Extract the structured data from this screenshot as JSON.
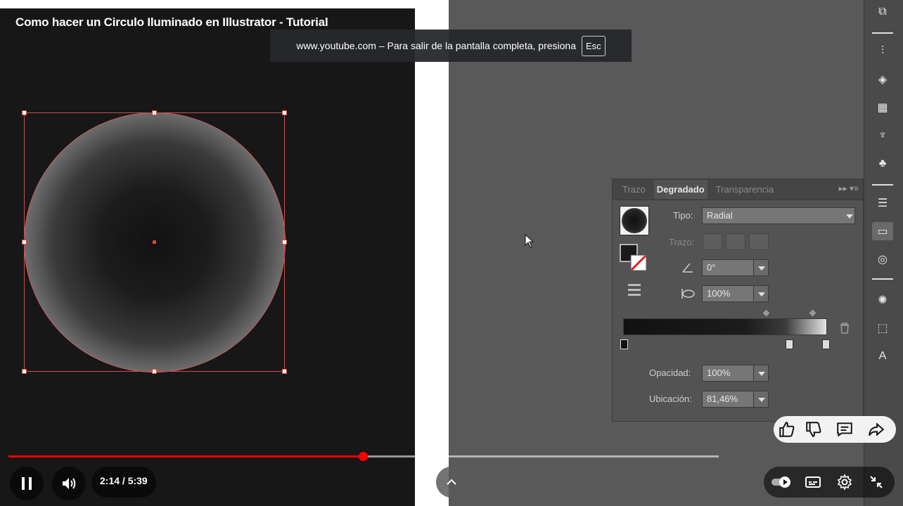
{
  "video": {
    "title": "Como hacer un Circulo Iluminado en Illustrator - Tutorial",
    "time_current": "2:14",
    "time_total": "5:39",
    "time_display": "2:14 / 5:39",
    "progress": 0.4,
    "buffered": 1.0
  },
  "fullscreen_banner": {
    "message": "www.youtube.com – Para salir de la pantalla completa, presiona",
    "key": "Esc"
  },
  "gradient_panel": {
    "tabs": [
      "Trazo",
      "Degradado",
      "Transparencia"
    ],
    "active_tab": "Degradado",
    "tipo_label": "Tipo:",
    "tipo_value": "Radial",
    "trazo_label": "Trazo:",
    "angle_value": "0°",
    "ratio_value": "100%",
    "opacity_label": "Opacidad:",
    "opacity_value": "100%",
    "location_label": "Ubicación:",
    "location_value": "81,46%"
  },
  "colors": {
    "progress": "#ff0000",
    "selection": "#c8504a",
    "panel_bg": "#535353",
    "canvas_dark": "#171718",
    "pasteboard": "#595959"
  },
  "icons": {
    "toolbar": [
      "arrange-icon",
      "properties-icon",
      "layers-icon",
      "libraries-icon",
      "brush-icon",
      "club-icon",
      "stroke-icon",
      "gradient-icon",
      "transparency-icon",
      "appearance-icon",
      "transform-icon",
      "character-icon"
    ],
    "controls": [
      "pause-icon",
      "volume-icon",
      "chevron-up-icon",
      "autoplay-toggle-icon",
      "subtitles-icon",
      "settings-icon",
      "exit-fullscreen-icon"
    ],
    "actions": [
      "like-icon",
      "dislike-icon",
      "comment-icon",
      "share-icon"
    ]
  }
}
